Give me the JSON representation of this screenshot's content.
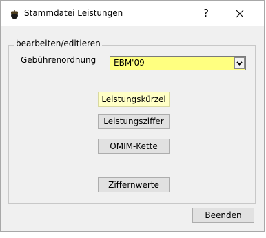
{
  "window": {
    "title": "Stammdatei Leistungen",
    "help_label": "?",
    "icon": "acorn-icon"
  },
  "group": {
    "label": "bearbeiten/editieren",
    "gebuehr_label": "Gebührenordnung",
    "gebuehr_value": "EBM'09"
  },
  "buttons": {
    "leistungskuerzel": "Leistungskürzel",
    "leistungsziffer": "Leistungsziffer",
    "omim_kette": "OMIM-Kette",
    "ziffernwerte": "Ziffernwerte",
    "beenden": "Beenden"
  },
  "colors": {
    "select_bg": "#ffff80",
    "highlight_button_bg": "#ffffc6",
    "window_bg": "#f0f0f0"
  }
}
